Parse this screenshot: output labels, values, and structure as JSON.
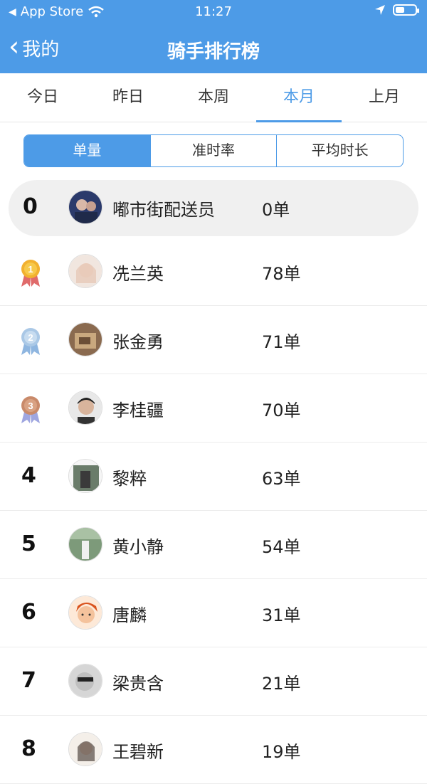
{
  "status_bar": {
    "back_app": "App Store",
    "time": "11:27"
  },
  "nav": {
    "back_label": "我的",
    "title": "骑手排行榜"
  },
  "tabs": [
    {
      "label": "今日"
    },
    {
      "label": "昨日"
    },
    {
      "label": "本周"
    },
    {
      "label": "本月",
      "active": true
    },
    {
      "label": "上月"
    }
  ],
  "segments": [
    {
      "label": "单量",
      "active": true
    },
    {
      "label": "准时率"
    },
    {
      "label": "平均时长"
    }
  ],
  "my_rank": {
    "rank": "0",
    "name": "嘟市街配送员",
    "count": "0单"
  },
  "ranking": [
    {
      "rank": "1",
      "name": "冼兰英",
      "count": "78单",
      "medal": "gold"
    },
    {
      "rank": "2",
      "name": "张金勇",
      "count": "71单",
      "medal": "silver"
    },
    {
      "rank": "3",
      "name": "李桂疆",
      "count": "70单",
      "medal": "bronze"
    },
    {
      "rank": "4",
      "name": "黎粹",
      "count": "63单"
    },
    {
      "rank": "5",
      "name": "黄小静",
      "count": "54单"
    },
    {
      "rank": "6",
      "name": "唐麟",
      "count": "31单"
    },
    {
      "rank": "7",
      "name": "梁贵含",
      "count": "21单"
    },
    {
      "rank": "8",
      "name": "王碧新",
      "count": "19单"
    }
  ],
  "colors": {
    "brand": "#4d9be7",
    "gold": "#f2b12f",
    "silver": "#aac8e6",
    "bronze": "#c98a6a"
  }
}
